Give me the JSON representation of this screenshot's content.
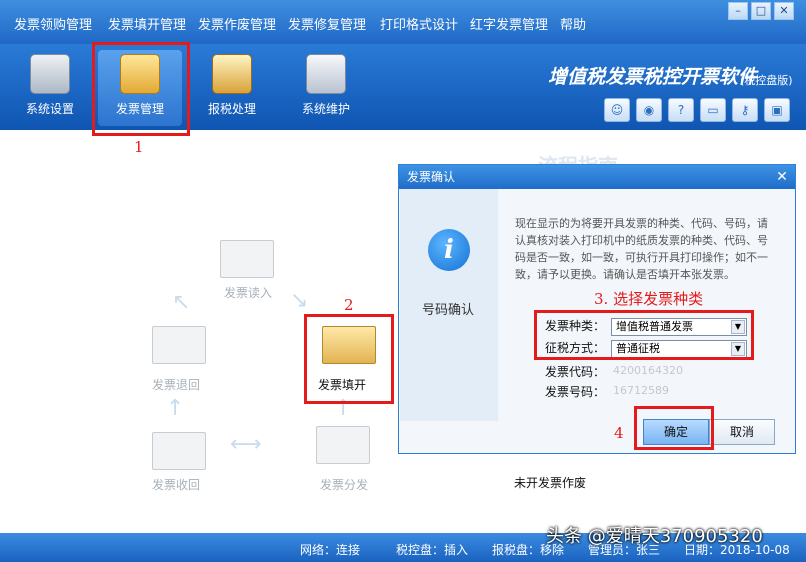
{
  "menu": [
    {
      "id": "purchase",
      "label": "发票领购管理"
    },
    {
      "id": "issue",
      "label": "发票填开管理"
    },
    {
      "id": "void",
      "label": "发票作废管理"
    },
    {
      "id": "repair",
      "label": "发票修复管理"
    },
    {
      "id": "print",
      "label": "打印格式设计"
    },
    {
      "id": "red",
      "label": "红字发票管理"
    },
    {
      "id": "help",
      "label": "帮助"
    }
  ],
  "window_buttons": {
    "min": "–",
    "max": "□",
    "close": "✕"
  },
  "toolbar": [
    {
      "label": "系统设置",
      "icon": "settings-icon"
    },
    {
      "label": "发票管理",
      "icon": "folder-icon"
    },
    {
      "label": "报税处理",
      "icon": "tax-icon"
    },
    {
      "label": "系统维护",
      "icon": "tools-icon"
    }
  ],
  "brand": {
    "title": "增值税发票税控开票软件",
    "subtitle": "(税控盘版)"
  },
  "annotations": {
    "step1": "1",
    "step2": "2",
    "step3": "3. 选择发票种类",
    "step4": "4"
  },
  "flow": {
    "read": "发票读入",
    "issue": "发票填开",
    "return": "发票退回",
    "recycle": "发票收回",
    "distribute": "发票分发",
    "unissued_void": "未开发票作废",
    "guide": "流程指南"
  },
  "dialog": {
    "title": "发票确认",
    "left_label": "号码确认",
    "description": "现在显示的为将要开具发票的种类、代码、号码，请认真核对装入打印机中的纸质发票的种类、代码、号码是否一致，如一致，可执行开具打印操作；如不一致，请予以更换。请确认是否填开本张发票。",
    "invoice_type_label": "发票种类：",
    "invoice_type_value": "增值税普通发票",
    "tax_method_label": "征税方式：",
    "tax_method_value": "普通征税",
    "code_label": "发票代码：",
    "code_value": "4200164320",
    "number_label": "发票号码：",
    "number_value": "16712589",
    "ok": "确定",
    "cancel": "取消"
  },
  "status": {
    "network": "网络：连接",
    "taxdisk": "税控盘：插入",
    "reportdisk": "报税盘：移除",
    "user": "管理员：张三",
    "date": "日期：2018-10-08"
  },
  "watermark": "头条 @爱晴天370905320",
  "colors": {
    "accent": "#1f68c6",
    "annotation": "#e31b1b"
  }
}
